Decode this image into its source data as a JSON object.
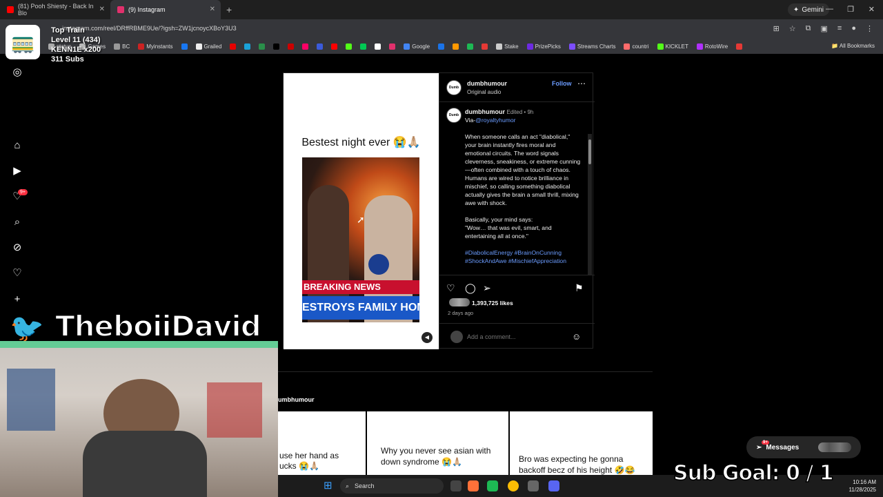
{
  "browser": {
    "tabs": [
      {
        "label": "(81) Pooh Shiesty - Back In Blo",
        "color": "#ff0000"
      },
      {
        "label": "(9) Instagram",
        "color": "#e1306c"
      }
    ],
    "gemini_label": "Gemini",
    "url": "instagram.com/reel/DRffRBME9Ue/?igsh=ZW1jcnoycXBoY3U3",
    "bookmarks": [
      {
        "label": "status",
        "color": "#aaaaaa"
      },
      {
        "label": "Games",
        "color": "#bbbbbb"
      },
      {
        "label": "BC",
        "color": "#999999"
      },
      {
        "label": "Myinstants",
        "color": "#cc2222"
      },
      {
        "label": "",
        "color": "#1877f2"
      },
      {
        "label": "Grailed",
        "color": "#eeeeee"
      },
      {
        "label": "",
        "color": "#e60000"
      },
      {
        "label": "",
        "color": "#1aa2d8"
      },
      {
        "label": "",
        "color": "#2a8f4a"
      },
      {
        "label": "",
        "color": "#000000"
      },
      {
        "label": "",
        "color": "#cc0000"
      },
      {
        "label": "",
        "color": "#ff0066"
      },
      {
        "label": "",
        "color": "#3b5bdb"
      },
      {
        "label": "",
        "color": "#ff0000"
      },
      {
        "label": "",
        "color": "#53fc18"
      },
      {
        "label": "",
        "color": "#00c853"
      },
      {
        "label": "",
        "color": "#ffffff"
      },
      {
        "label": "",
        "color": "#e1306c"
      },
      {
        "label": "Google",
        "color": "#4285f4"
      },
      {
        "label": "",
        "color": "#1a73e8"
      },
      {
        "label": "",
        "color": "#ff9900"
      },
      {
        "label": "",
        "color": "#1db954"
      },
      {
        "label": "",
        "color": "#e53935"
      },
      {
        "label": "Stake",
        "color": "#cccccc"
      },
      {
        "label": "PrizePicks",
        "color": "#6d2ae2"
      },
      {
        "label": "Streams Charts",
        "color": "#7c4dff"
      },
      {
        "label": "countri",
        "color": "#ff6b6b"
      },
      {
        "label": "KICKLET",
        "color": "#53fc18"
      },
      {
        "label": "RotoWire",
        "color": "#b030ff"
      },
      {
        "label": "",
        "color": "#e53935"
      }
    ],
    "all_bookmarks": "All Bookmarks"
  },
  "overlay": {
    "train_title": "Top Train",
    "train_level": "Level 11  (434)",
    "train_user": "KENN1E x200",
    "subs": "311 Subs",
    "handle": "TheboiiDavid",
    "sub_goal": "Sub Goal:  0 / 1"
  },
  "sidebar": {
    "notifications_badge": "9+",
    "icons": [
      "instagram-icon",
      "home-icon",
      "reels-icon",
      "notifications-icon",
      "search-icon",
      "explore-icon",
      "heart-icon",
      "create-icon"
    ]
  },
  "post": {
    "media_title": "Bestest night ever 😭🙏🏼",
    "breaking": "BREAKING NEWS",
    "headline": "ESTROYS FAMILY HOM",
    "author": "dumbhumour",
    "audio": "Original audio",
    "follow": "Follow",
    "caption_meta": "Edited • 9h",
    "via_prefix": "Via-",
    "via_handle": "@royaltyhumor",
    "caption_p1": "When someone calls an act \"diabolical,\" your brain instantly fires moral and emotional circuits. The word signals cleverness, sneakiness, or extreme cunning—often combined with a touch of chaos. Humans are wired to notice brilliance in mischief, so calling something diabolical actually gives the brain a small thrill, mixing awe with shock.",
    "caption_p2a": "Basically, your mind says:",
    "caption_p2b": "\"Wow… that was evil, smart, and entertaining all at once.\"",
    "hashtags": "#DiabolicalEnergy #BrainOnCunning #ShockAndAwe #MischiefAppreciation",
    "likes": "1,393,725 likes",
    "time": "2 days ago",
    "comment_placeholder": "Add a comment..."
  },
  "more_posts": {
    "user": "umbhumour",
    "items": [
      {
        "line1": "use her hand as",
        "line2": "ucks 😭🙏🏼"
      },
      {
        "line1": "Why you never see asian with",
        "line2": "down syndrome 😭🙏🏼"
      },
      {
        "line1": "Bro was expecting he gonna",
        "line2": "backoff becz of his height 🤣😂"
      }
    ]
  },
  "messages": {
    "label": "Messages",
    "badge": "9+"
  },
  "taskbar": {
    "search": "Search",
    "time": "10:16 AM",
    "date": "11/28/2025"
  }
}
